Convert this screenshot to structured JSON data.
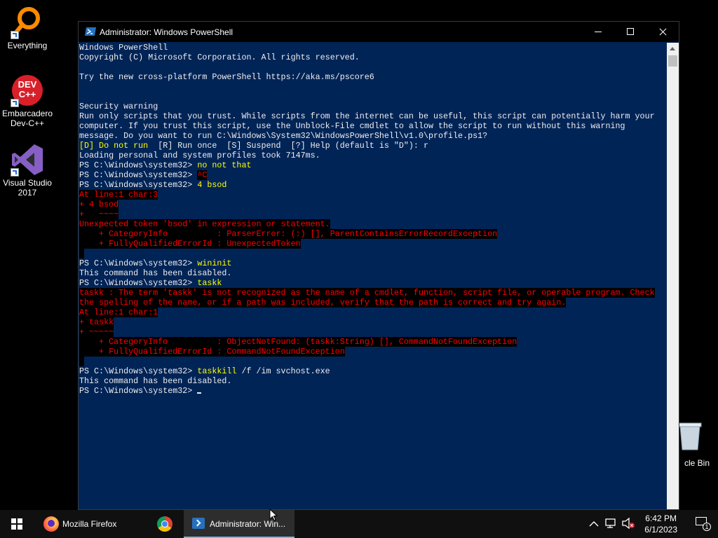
{
  "desktop": {
    "icons": [
      {
        "label": "Everything",
        "icon": "everything-search-icon"
      },
      {
        "label": "Embarcadero Dev-C++",
        "icon": "devcpp-icon",
        "badge_text": "DEV C++"
      },
      {
        "label": "Visual Studio 2017",
        "icon": "visual-studio-icon"
      }
    ],
    "recycle_bin": {
      "label": "Recycle Bin",
      "visible_label": "cle Bin",
      "icon": "recycle-bin-icon"
    }
  },
  "window": {
    "title": "Administrator: Windows PowerShell",
    "icon": "powershell-icon",
    "controls": [
      "minimize-icon",
      "maximize-icon",
      "close-icon"
    ]
  },
  "console": {
    "colors": {
      "background": "#012456",
      "text": "#eeedf0",
      "input": "#ffff00",
      "error_fg": "#ff0000",
      "error_bg": "#000000"
    },
    "lines": [
      {
        "segments": [
          {
            "t": "Windows PowerShell"
          }
        ]
      },
      {
        "segments": [
          {
            "t": "Copyright (C) Microsoft Corporation. All rights reserved."
          }
        ]
      },
      {
        "segments": [
          {
            "t": ""
          }
        ]
      },
      {
        "segments": [
          {
            "t": "Try the new cross-platform PowerShell https://aka.ms/pscore6"
          }
        ]
      },
      {
        "segments": [
          {
            "t": ""
          }
        ]
      },
      {
        "segments": [
          {
            "t": ""
          }
        ]
      },
      {
        "segments": [
          {
            "t": "Security warning"
          }
        ]
      },
      {
        "segments": [
          {
            "t": "Run only scripts that you trust. While scripts from the internet can be useful, this script can potentially harm your"
          }
        ]
      },
      {
        "segments": [
          {
            "t": "computer. If you trust this script, use the Unblock-File cmdlet to allow the script to run without this warning"
          }
        ]
      },
      {
        "segments": [
          {
            "t": "message. Do you want to run C:\\Windows\\System32\\WindowsPowerShell\\v1.0\\profile.ps1?"
          }
        ]
      },
      {
        "segments": [
          {
            "t": "[D] Do not run  ",
            "c": "y"
          },
          {
            "t": "[R] Run once  [S] Suspend  [?] Help (default is \"D\"): r"
          }
        ]
      },
      {
        "segments": [
          {
            "t": "Loading personal and system profiles took 7147ms."
          }
        ]
      },
      {
        "segments": [
          {
            "t": "PS C:\\Windows\\system32> "
          },
          {
            "t": "no not that",
            "c": "y"
          }
        ]
      },
      {
        "segments": [
          {
            "t": "PS C:\\Windows\\system32> "
          },
          {
            "t": "^C",
            "c": "err"
          }
        ]
      },
      {
        "segments": [
          {
            "t": "PS C:\\Windows\\system32> "
          },
          {
            "t": "4 bsod",
            "c": "y"
          }
        ]
      },
      {
        "segments": [
          {
            "t": "At line:1 char:3",
            "c": "err"
          }
        ]
      },
      {
        "segments": [
          {
            "t": "+ 4 bsod",
            "c": "err"
          }
        ]
      },
      {
        "segments": [
          {
            "t": "+   ~~~~",
            "c": "err"
          }
        ]
      },
      {
        "segments": [
          {
            "t": "Unexpected token 'bsod' in expression or statement.",
            "c": "err"
          }
        ]
      },
      {
        "segments": [
          {
            "t": "    + CategoryInfo          : ParserError: (:) [], ParentContainsErrorRecordException",
            "c": "err"
          }
        ]
      },
      {
        "segments": [
          {
            "t": "    + FullyQualifiedErrorId : UnexpectedToken",
            "c": "err"
          }
        ]
      },
      {
        "segments": [
          {
            "t": " ",
            "c": "err"
          }
        ]
      },
      {
        "segments": [
          {
            "t": "PS C:\\Windows\\system32> "
          },
          {
            "t": "wininit",
            "c": "y"
          }
        ]
      },
      {
        "segments": [
          {
            "t": "This command has been disabled."
          }
        ]
      },
      {
        "segments": [
          {
            "t": "PS C:\\Windows\\system32> "
          },
          {
            "t": "taskk",
            "c": "y"
          }
        ]
      },
      {
        "segments": [
          {
            "t": "taskk : The term 'taskk' is not recognized as the name of a cmdlet, function, script file, or operable program. Check",
            "c": "err"
          }
        ]
      },
      {
        "segments": [
          {
            "t": "the spelling of the name, or if a path was included, verify that the path is correct and try again.",
            "c": "err"
          }
        ]
      },
      {
        "segments": [
          {
            "t": "At line:1 char:1",
            "c": "err"
          }
        ]
      },
      {
        "segments": [
          {
            "t": "+ taskk",
            "c": "err"
          }
        ]
      },
      {
        "segments": [
          {
            "t": "+ ~~~~~",
            "c": "err"
          }
        ]
      },
      {
        "segments": [
          {
            "t": "    + CategoryInfo          : ObjectNotFound: (taskk:String) [], CommandNotFoundException",
            "c": "err"
          }
        ]
      },
      {
        "segments": [
          {
            "t": "    + FullyQualifiedErrorId : CommandNotFoundException",
            "c": "err"
          }
        ]
      },
      {
        "segments": [
          {
            "t": " ",
            "c": "err"
          }
        ]
      },
      {
        "segments": [
          {
            "t": "PS C:\\Windows\\system32> "
          },
          {
            "t": "taskkill",
            "c": "y"
          },
          {
            "t": " /f /im svchost.exe"
          }
        ]
      },
      {
        "segments": [
          {
            "t": "This command has been disabled."
          }
        ]
      },
      {
        "segments": [
          {
            "t": "PS C:\\Windows\\system32> "
          }
        ],
        "cursor": true
      }
    ]
  },
  "taskbar": {
    "start_icon": "windows-logo-icon",
    "apps": [
      {
        "label": "Mozilla Firefox",
        "icon": "firefox-icon",
        "active": false
      },
      {
        "label": "",
        "icon": "chrome-icon",
        "active": false
      },
      {
        "label": "Administrator: Win...",
        "icon": "powershell-icon",
        "active": true
      }
    ],
    "tray": {
      "icons": [
        "chevron-up-icon",
        "network-icon",
        "volume-muted-icon"
      ],
      "time": "6:42 PM",
      "date": "6/1/2023",
      "notification_count": "1"
    }
  }
}
